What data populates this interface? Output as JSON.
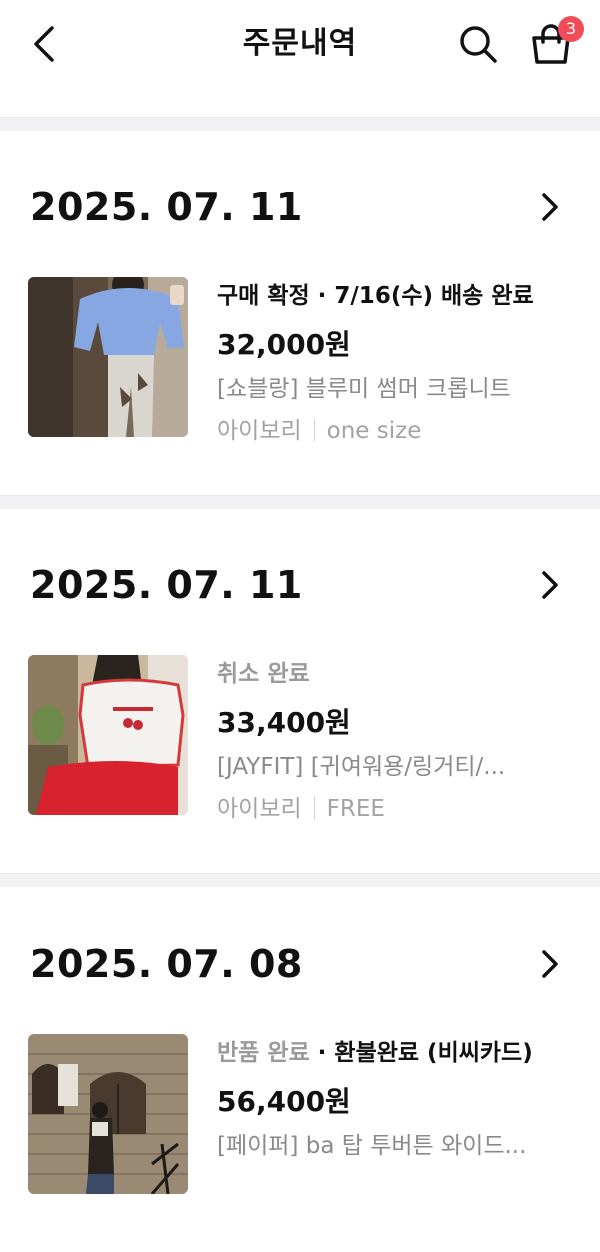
{
  "header": {
    "title": "주문내역",
    "back_icon": "chevron-left-icon",
    "search_icon": "search-icon",
    "cart_icon": "shopping-bag-icon",
    "cart_count": "3",
    "badge_color": "#ef4d5a"
  },
  "orders": [
    {
      "date": "2025. 07. 11",
      "status_primary": "구매 확정",
      "status_secondary": " · 7/16(수) 배송 완료",
      "price": "32,000원",
      "product_name": "[쇼블랑] 블루미 썸머 크롭니트",
      "option_color": "아이보리",
      "option_size": "one size"
    },
    {
      "date": "2025. 07. 11",
      "status_primary": "취소 완료",
      "status_secondary": "",
      "price": "33,400원",
      "product_name": "[JAYFIT] [귀여워용/링거티/...",
      "option_color": "아이보리",
      "option_size": "FREE"
    },
    {
      "date": "2025. 07. 08",
      "status_primary": "반품 완료",
      "status_secondary": " · 환불완료 (비씨카드)",
      "price": "56,400원",
      "product_name": "[페이퍼] ba 탑 투버튼 와이드...",
      "option_color": "",
      "option_size": ""
    }
  ]
}
